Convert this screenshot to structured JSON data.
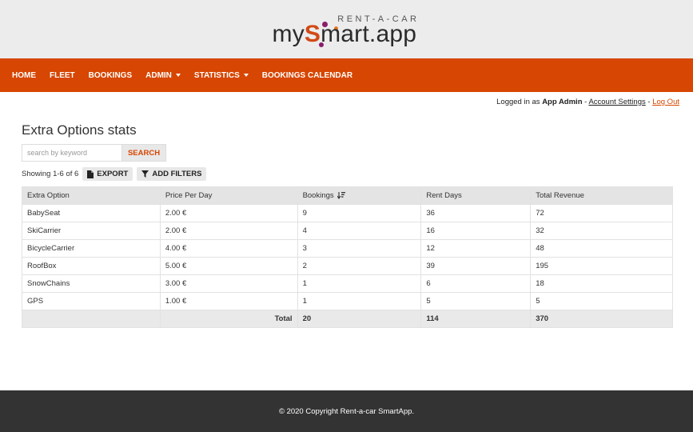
{
  "brand": {
    "tagline": "RENT-A-CAR",
    "name_prefix": "my",
    "name_s": "S",
    "name_suffix": "mart.app",
    "accent": "#d74602"
  },
  "nav": {
    "items": [
      {
        "label": "HOME",
        "dropdown": false
      },
      {
        "label": "FLEET",
        "dropdown": false
      },
      {
        "label": "BOOKINGS",
        "dropdown": false
      },
      {
        "label": "ADMIN",
        "dropdown": true
      },
      {
        "label": "STATISTICS",
        "dropdown": true
      },
      {
        "label": "BOOKINGS CALENDAR",
        "dropdown": false
      }
    ]
  },
  "user": {
    "logged_in_prefix": "Logged in as",
    "name": "App Admin",
    "sep1": "-",
    "account_settings": "Account Settings",
    "sep2": "-",
    "logout": "Log Out"
  },
  "page": {
    "title": "Extra Options stats"
  },
  "search": {
    "placeholder": "search by keyword",
    "value": "",
    "button": "SEARCH"
  },
  "toolbar": {
    "showing": "Showing 1-6 of 6",
    "export": "EXPORT",
    "add_filters": "ADD FILTERS"
  },
  "table": {
    "headers": [
      "Extra Option",
      "Price Per Day",
      "Bookings",
      "Rent Days",
      "Total Revenue"
    ],
    "rows": [
      [
        "BabySeat",
        "2.00 €",
        "9",
        "36",
        "72"
      ],
      [
        "SkiCarrier",
        "2.00 €",
        "4",
        "16",
        "32"
      ],
      [
        "BicycleCarrier",
        "4.00 €",
        "3",
        "12",
        "48"
      ],
      [
        "RoofBox",
        "5.00 €",
        "2",
        "39",
        "195"
      ],
      [
        "SnowChains",
        "3.00 €",
        "1",
        "6",
        "18"
      ],
      [
        "GPS",
        "1.00 €",
        "1",
        "5",
        "5"
      ]
    ],
    "total": {
      "label": "Total",
      "bookings": "20",
      "rent_days": "114",
      "revenue": "370"
    }
  },
  "footer": {
    "text": "© 2020 Copyright Rent-a-car SmartApp."
  }
}
